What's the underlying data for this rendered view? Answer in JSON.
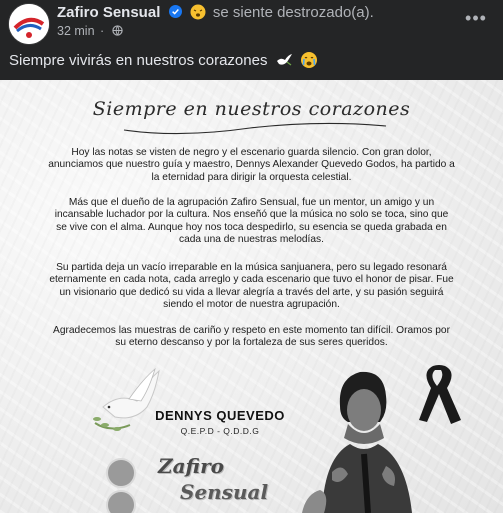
{
  "post": {
    "author": "Zafiro Sensual",
    "feeling_text": "se siente destrozado(a).",
    "time": "32 min",
    "dot": "·",
    "more_label": "•••",
    "caption": "Siempre vivirás en nuestros corazones"
  },
  "image": {
    "script_title": "Siempre en nuestros corazones",
    "paragraph_1": "Hoy las notas se visten de negro y el escenario guarda silencio. Con gran dolor, anunciamos que nuestro guía y maestro, Dennys Alexander Quevedo Godos, ha partido a la eternidad para dirigir la orquesta celestial.",
    "paragraph_2": "Más que el dueño de la agrupación Zafiro Sensual, fue un mentor, un amigo y un incansable luchador por la cultura. Nos enseñó que la música no solo se toca, sino que se vive con el alma. Aunque hoy nos toca despedirlo, su esencia se queda grabada en cada una de nuestras melodías.",
    "paragraph_3": "Su partida deja un vacío irreparable en la música sanjuanera, pero su legado resonará eternamente en cada nota, cada arreglo y cada escenario que tuvo el honor de pisar. Fue un visionario que dedicó su vida a llevar alegría a través del arte, y su pasión seguirá siendo el motor de nuestra agrupación.",
    "paragraph_4": "Agradecemos las muestras de cariño y respeto en este momento tan difícil. Oramos por su eterno descanso y por la fortaleza de sus seres queridos.",
    "name": "DENNYS QUEVEDO",
    "name_sub": "Q.E.P.D - Q.D.D.G",
    "logo_line1": "Zafiro",
    "logo_line2": "Sensual"
  },
  "colors": {
    "background": "#242526",
    "verified": "#1877f2",
    "secondary_text": "#b0b3b8"
  },
  "icons": [
    "verified-badge-icon",
    "feeling-emoji-icon",
    "globe-icon",
    "dove-emoji-icon",
    "crying-emoji-icon",
    "more-options-icon",
    "dove-icon",
    "mourning-ribbon-icon"
  ]
}
